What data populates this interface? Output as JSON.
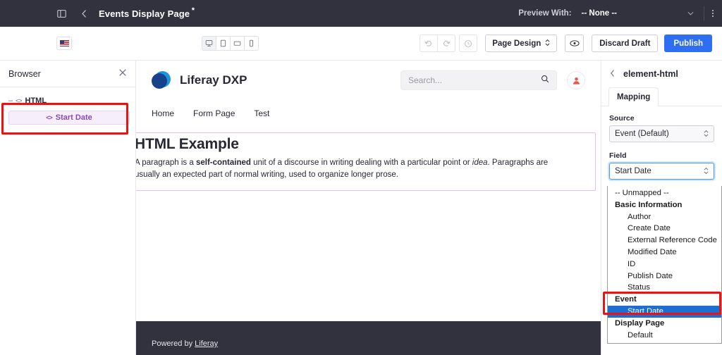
{
  "topbar": {
    "panel_toggle_icon": "panel-toggle-icon",
    "back_icon": "chevron-left-icon",
    "page_title": "Events Display Page",
    "unsaved_marker": "*",
    "preview_label": "Preview With:",
    "preview_value": "-- None --",
    "dropdown_caret_icon": "chevron-down-icon",
    "kebab_icon": "vertical-ellipsis-icon"
  },
  "toolbar": {
    "language_flag": "us-flag-icon",
    "devices": [
      {
        "name": "desktop",
        "label": "Desktop",
        "active": true
      },
      {
        "name": "tablet-portrait",
        "label": "Tablet Portrait",
        "active": false
      },
      {
        "name": "tablet-landscape",
        "label": "Tablet Landscape",
        "active": false
      },
      {
        "name": "mobile",
        "label": "Mobile",
        "active": false
      }
    ],
    "undo_icon": "undo-icon",
    "redo_icon": "redo-icon",
    "history_icon": "history-clock-icon",
    "page_design_label": "Page Design",
    "page_design_caret": "updown-caret-icon",
    "preview_eye_icon": "eye-icon",
    "discard_label": "Discard Draft",
    "publish_label": "Publish",
    "publish_color": "#2e6ef0"
  },
  "browser": {
    "title": "Browser",
    "close_icon": "close-icon",
    "tree": {
      "collapse_toggle": "–",
      "item_icon": "code-brackets-icon",
      "root_label": "HTML",
      "child_label": "Start Date",
      "child_color": "#8b49b5"
    },
    "annotation_color": "#ef1010"
  },
  "canvas": {
    "site_name": "Liferay DXP",
    "logo_icon": "liferay-logo-icon",
    "search": {
      "placeholder": "Search...",
      "icon": "search-icon"
    },
    "avatar_icon": "user-avatar-icon",
    "nav": [
      {
        "label": "Home"
      },
      {
        "label": "Form Page"
      },
      {
        "label": "Test"
      }
    ],
    "fragment": {
      "heading": "HTML Example",
      "paragraph_part1": "A paragraph is a ",
      "paragraph_bold": "self-contained",
      "paragraph_part2": " unit of a discourse in writing dealing with a particular point or ",
      "paragraph_italic": "idea",
      "paragraph_part3": ". Paragraphs are usually an expected part of normal writing, used to organize longer prose."
    },
    "footer": {
      "prefix": "Powered by ",
      "link": "Liferay"
    }
  },
  "right_panel": {
    "back_icon": "chevron-left-icon",
    "title": "element-html",
    "tabs": [
      {
        "label": "Mapping",
        "active": true
      }
    ],
    "source": {
      "label": "Source",
      "value": "Event (Default)"
    },
    "field": {
      "label": "Field",
      "value": "Start Date"
    },
    "dropdown": {
      "open": true,
      "highlight_color": "#1c6fd0",
      "annotation_color": "#ef1010",
      "options": [
        {
          "label": "-- Unmapped --",
          "type": "plain",
          "selected": false
        },
        {
          "label": "Basic Information",
          "type": "group",
          "selected": false
        },
        {
          "label": "Author",
          "type": "item",
          "selected": false
        },
        {
          "label": "Create Date",
          "type": "item",
          "selected": false
        },
        {
          "label": "External Reference Code",
          "type": "item",
          "selected": false
        },
        {
          "label": "Modified Date",
          "type": "item",
          "selected": false
        },
        {
          "label": "ID",
          "type": "item",
          "selected": false
        },
        {
          "label": "Publish Date",
          "type": "item",
          "selected": false
        },
        {
          "label": "Status",
          "type": "item",
          "selected": false
        },
        {
          "label": "Event",
          "type": "group",
          "selected": false
        },
        {
          "label": "Start Date",
          "type": "item",
          "selected": true
        },
        {
          "label": "Display Page",
          "type": "group",
          "selected": false
        },
        {
          "label": "Default",
          "type": "item",
          "selected": false
        }
      ]
    }
  }
}
